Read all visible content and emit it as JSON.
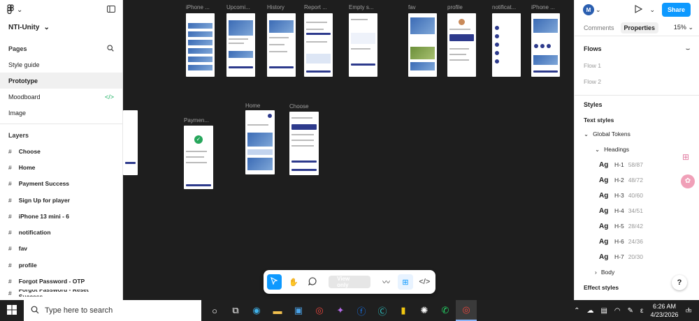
{
  "left": {
    "project_name": "NTI-Unity",
    "pages_title": "Pages",
    "pages": [
      "Style guide",
      "Prototype",
      "Moodboard",
      "Image"
    ],
    "active_page": "Prototype",
    "layers_title": "Layers",
    "layers": [
      "Choose",
      "Home",
      "Payment Success",
      "Sign Up for player",
      "iPhone 13 mini - 6",
      "notification",
      "fav",
      "profile",
      "Forgot Password - OTP",
      "Forgot Password - Reset Success"
    ]
  },
  "canvas": {
    "frame_labels": [
      "iPhone ...",
      "Upcomi...",
      "History",
      "Report ...",
      "Empty s...",
      "fav",
      "profile",
      "notificat...",
      "iPhone ...",
      "Paymen...",
      "Home",
      "Choose"
    ]
  },
  "toolbar": {
    "view_only": "View only"
  },
  "right": {
    "avatar_letter": "M",
    "share_label": "Share",
    "tab_comments": "Comments",
    "tab_properties": "Properties",
    "zoom": "15%",
    "flows_title": "Flows",
    "flows": [
      "Flow 1",
      "Flow 2"
    ],
    "styles_title": "Styles",
    "text_styles_title": "Text styles",
    "global_tokens": "Global Tokens",
    "headings": "Headings",
    "text_styles": [
      {
        "name": "H-1",
        "val": "58/87"
      },
      {
        "name": "H-2",
        "val": "48/72"
      },
      {
        "name": "H-3",
        "val": "40/60"
      },
      {
        "name": "H-4",
        "val": "34/51"
      },
      {
        "name": "H-5",
        "val": "28/42"
      },
      {
        "name": "H-6",
        "val": "24/36"
      },
      {
        "name": "H-7",
        "val": "20/30"
      }
    ],
    "ag_label": "Ag",
    "body": "Body",
    "effect_styles": "Effect styles",
    "help": "?"
  },
  "taskbar": {
    "search_placeholder": "Type here to search",
    "time": "6:26 AM",
    "date": "4/23/2026",
    "notif_count": "1"
  },
  "colors": {
    "accent": "#0d99ff",
    "canvas": "#1e1e1e",
    "frame_primary": "#2d3a8c"
  }
}
